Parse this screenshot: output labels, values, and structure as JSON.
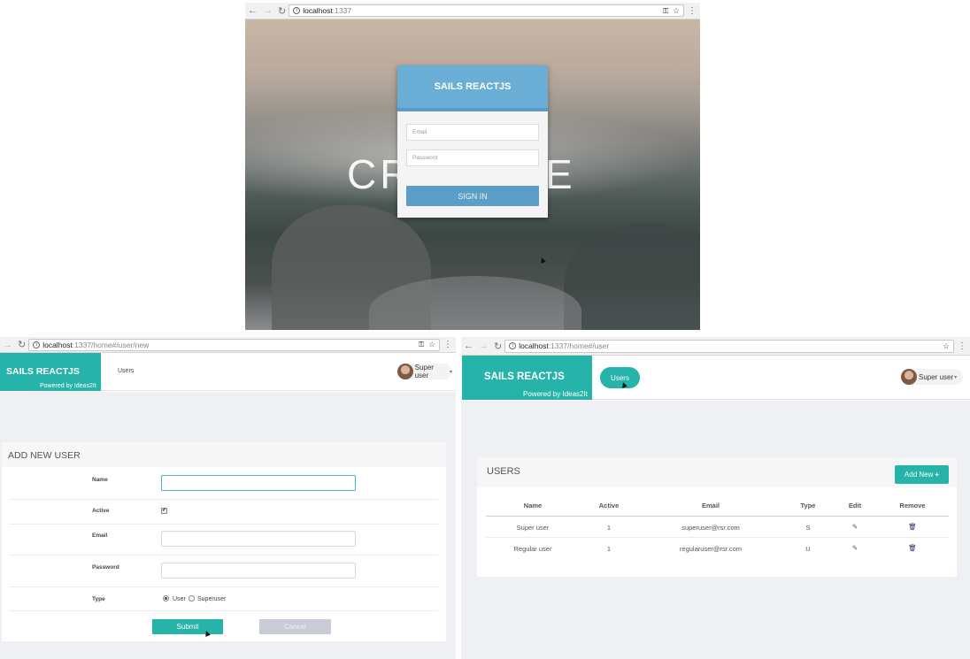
{
  "login_window": {
    "url_host": "localhost",
    "url_path": ":1337",
    "background_word": "CREATIVE",
    "card_title": "SAILS REACTJS",
    "email_placeholder": "Email",
    "password_placeholder": "Password",
    "signin_label": "SIGN IN"
  },
  "new_user_window": {
    "url_host": "localhost",
    "url_path": ":1337/home#/user/new",
    "brand_title": "SAILS REACTJS",
    "brand_sub": "Powered by Ideas2It",
    "nav_users": "Users",
    "user_menu": "Super user",
    "card_title": "ADD NEW USER",
    "labels": {
      "name": "Name",
      "active": "Active",
      "email": "Email",
      "password": "Password",
      "type": "Type"
    },
    "type_options": [
      "User",
      "Superuser"
    ],
    "type_selected": "User",
    "active_checked": "✔",
    "submit_label": "Submit",
    "cancel_label": "Cancel"
  },
  "users_window": {
    "url_host": "localhost",
    "url_path": ":1337/home#/user",
    "brand_title": "SAILS REACTJS",
    "brand_sub": "Powered by Ideas2It",
    "nav_users": "Users",
    "user_menu": "Super user",
    "card_title": "USERS",
    "add_new_label": "Add New",
    "columns": [
      "Name",
      "Active",
      "Email",
      "Type",
      "Edit",
      "Remove"
    ],
    "rows": [
      {
        "name": "Super user",
        "active": "1",
        "email": "superuser@rsr.com",
        "type": "S"
      },
      {
        "name": "Regular user",
        "active": "1",
        "email": "regularuser@rsr.com",
        "type": "U"
      }
    ]
  },
  "icons": {
    "back": "back-arrow-icon",
    "forward": "forward-arrow-icon",
    "reload": "reload-icon",
    "info": "info-icon",
    "key": "key-icon",
    "star": "star-icon",
    "menu": "kebab-menu-icon",
    "edit": "edit-icon",
    "remove": "trash-icon",
    "plus": "plus-icon"
  },
  "colors": {
    "brand": "#26b3a9",
    "login_header": "#6aaed6",
    "signin": "#5b9ec6",
    "cancel": "#c7ccd6",
    "page_bg": "#eff0f4"
  }
}
